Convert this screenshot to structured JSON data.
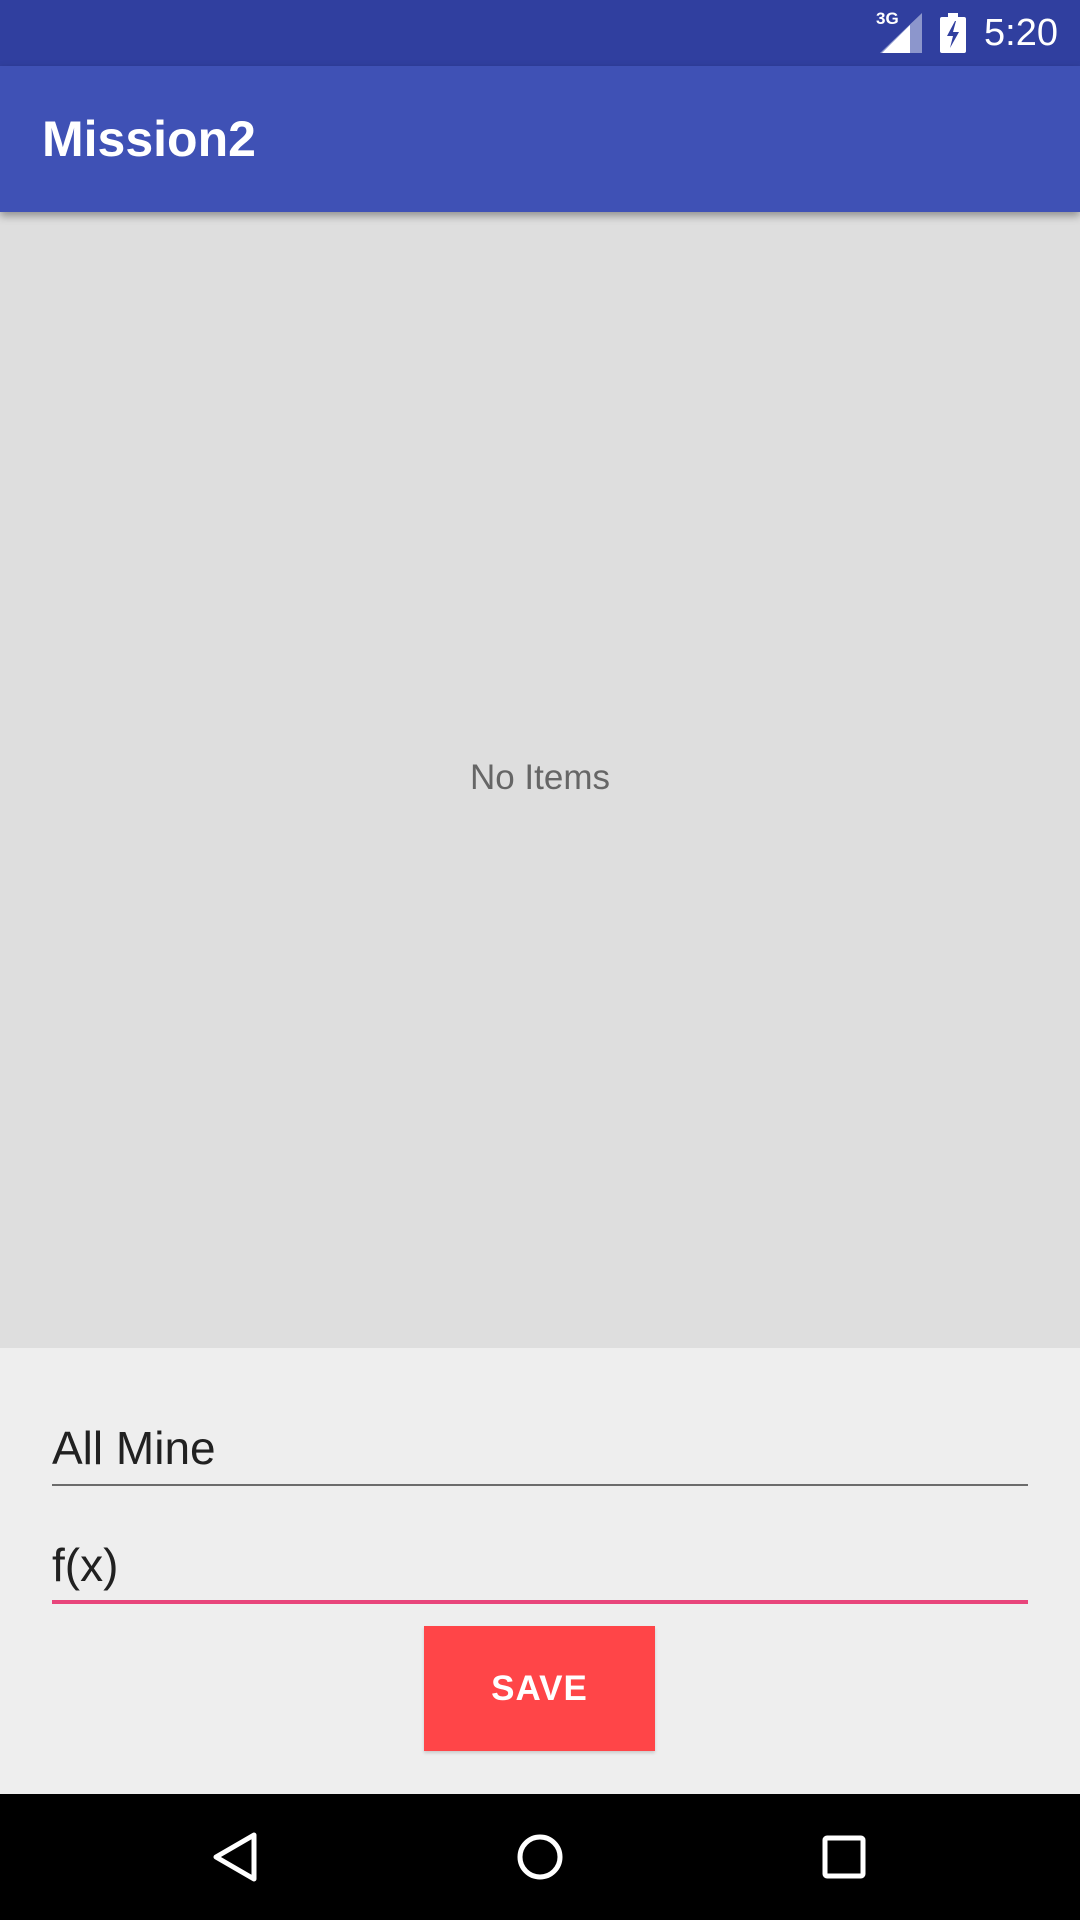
{
  "status_bar": {
    "network_label": "3G",
    "time": "5:20",
    "icons": [
      "signal-icon",
      "battery-charging-icon"
    ]
  },
  "app_bar": {
    "title": "Mission2"
  },
  "list": {
    "empty_text": "No Items"
  },
  "form": {
    "field_1_value": "All Mine",
    "field_2_value": "f(x)",
    "save_label": "SAVE"
  },
  "nav_bar": {
    "icons": [
      "back-icon",
      "home-icon",
      "recents-icon"
    ]
  },
  "colors": {
    "status_bar": "#303f9f",
    "app_bar": "#3f51b5",
    "list_background": "#dedede",
    "accent": "#e8457b",
    "save_button": "#ff4548"
  }
}
